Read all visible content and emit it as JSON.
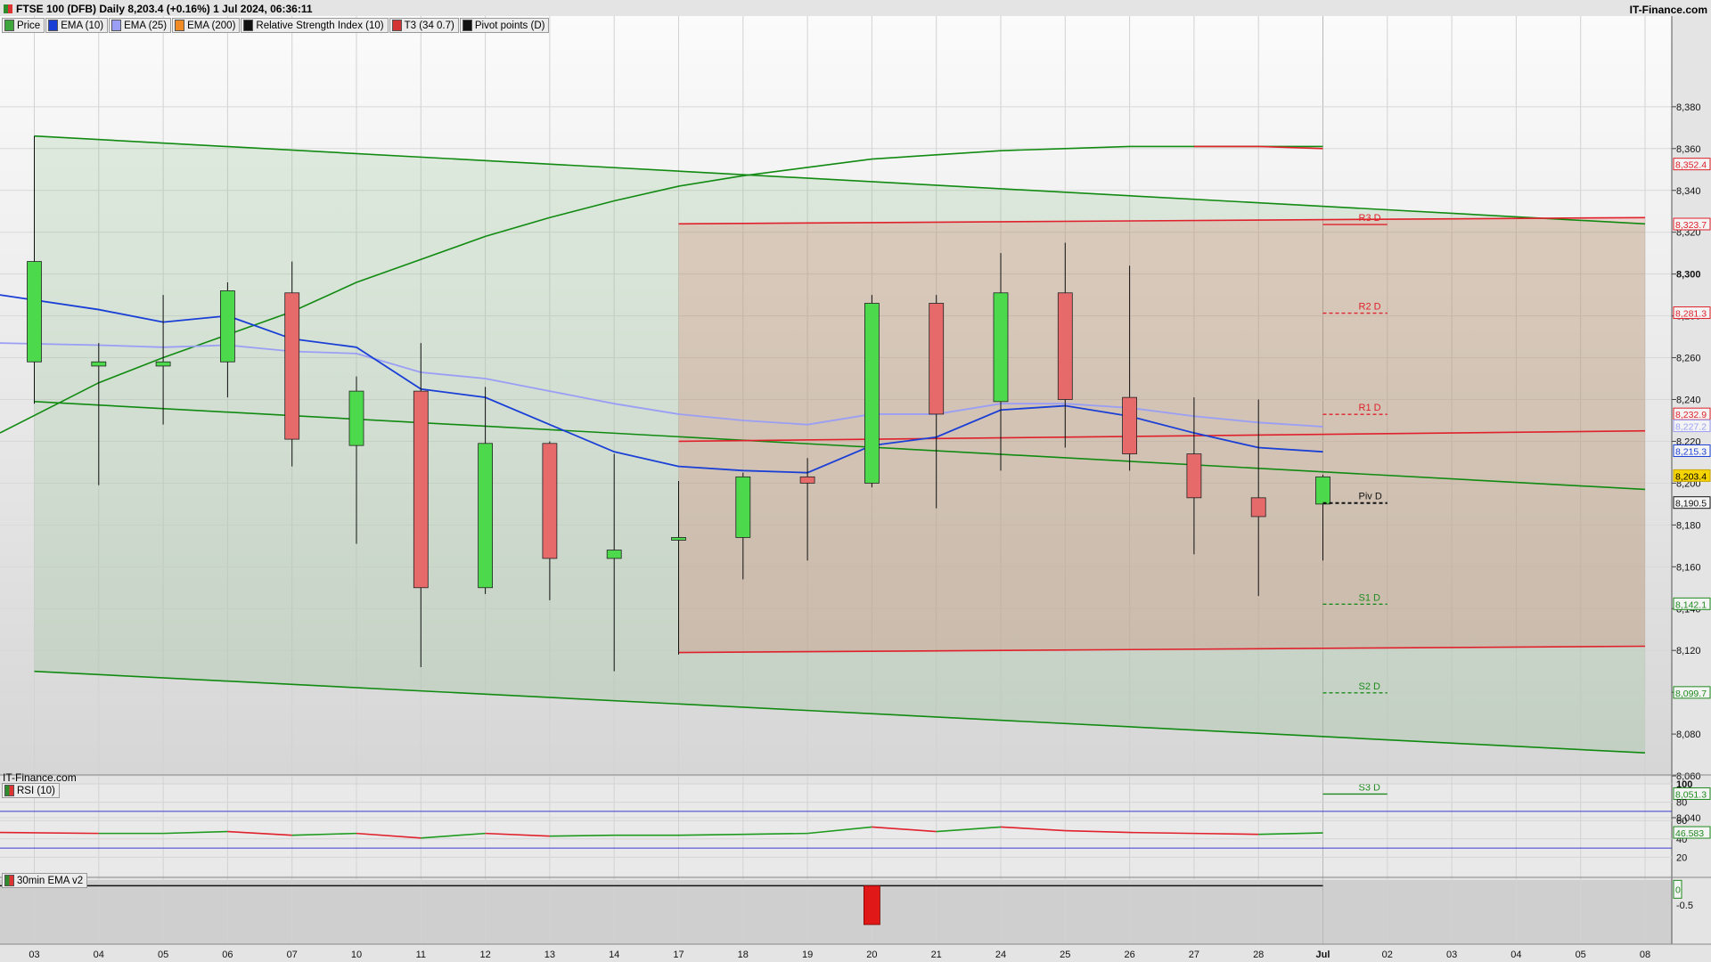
{
  "header": {
    "title": "FTSE 100 (DFB) Daily 8,203.4 (+0.16%) 1 Jul 2024, 06:36:11",
    "brand": "IT-Finance.com",
    "watermark": "IT-Finance.com"
  },
  "legend": [
    {
      "label": "Price",
      "color": "#3da63d"
    },
    {
      "label": "EMA (10)",
      "color": "#1a3fd6"
    },
    {
      "label": "EMA (25)",
      "color": "#9a9ef5"
    },
    {
      "label": "EMA (200)",
      "color": "#f08a24"
    },
    {
      "label": "Relative Strength Index (10)",
      "color": "#111111"
    },
    {
      "label": "T3 (34 0.7)",
      "color": "#d33333"
    },
    {
      "label": "Pivot points (D)",
      "color": "#111111"
    }
  ],
  "panels": {
    "rsi_label": "RSI (10)",
    "ema30_label": "30min EMA v2"
  },
  "colors": {
    "up": "#4cd94c",
    "down": "#e66a6a",
    "ema10": "#1a3fd6",
    "ema25": "#9a9ef5",
    "channel": "#118a11",
    "box": "#e0202a",
    "current": "#f5d400"
  },
  "chart_data": [
    {
      "type": "candlestick",
      "x": [
        "03",
        "04",
        "05",
        "06",
        "07",
        "10",
        "11",
        "12",
        "13",
        "14",
        "17",
        "18",
        "19",
        "20",
        "21",
        "24",
        "25",
        "26",
        "27",
        "28",
        "Jul"
      ],
      "future_x": [
        "02",
        "03",
        "04",
        "05",
        "08"
      ],
      "ylim": [
        8023,
        8388
      ],
      "y_ticks": [
        8040,
        8060,
        8080,
        8100,
        8120,
        8140,
        8160,
        8180,
        8200,
        8220,
        8240,
        8260,
        8280,
        8300,
        8320,
        8340,
        8360,
        8380
      ],
      "ohlc": [
        [
          8258,
          8366,
          8238,
          8306
        ],
        [
          8256,
          8267,
          8199,
          8258
        ],
        [
          8256,
          8290,
          8228,
          8258
        ],
        [
          8258,
          8296,
          8241,
          8292
        ],
        [
          8291,
          8306,
          8208,
          8221
        ],
        [
          8218,
          8251,
          8171,
          8244
        ],
        [
          8244,
          8267,
          8112,
          8150
        ],
        [
          8150,
          8246,
          8147,
          8219
        ],
        [
          8219,
          8220,
          8144,
          8164
        ],
        [
          8164,
          8214,
          8110,
          8168
        ],
        [
          8174,
          8201,
          8118,
          8174
        ],
        [
          8174,
          8205,
          8154,
          8203
        ],
        [
          8203,
          8212,
          8163,
          8200
        ],
        [
          8200,
          8290,
          8198,
          8286
        ],
        [
          8286,
          8290,
          8188,
          8233
        ],
        [
          8239,
          8310,
          8206,
          8291
        ],
        [
          8291,
          8315,
          8217,
          8240
        ],
        [
          8241,
          8304,
          8206,
          8214
        ],
        [
          8214,
          8241,
          8166,
          8193
        ],
        [
          8193,
          8240,
          8146,
          8184
        ],
        [
          8190,
          8204,
          8163,
          8203
        ]
      ],
      "ema10": [
        8290,
        8283,
        8277,
        8280,
        8269,
        8265,
        8245,
        8241,
        8228,
        8215,
        8208,
        8206,
        8205,
        8218,
        8222,
        8235,
        8237,
        8232,
        8224,
        8217,
        8215
      ],
      "ema25": [
        8267,
        8266,
        8265,
        8266,
        8263,
        8262,
        8253,
        8250,
        8244,
        8238,
        8233,
        8230,
        8228,
        8233,
        8233,
        8238,
        8238,
        8236,
        8232,
        8229,
        8227
      ],
      "curve_upper": [
        8224,
        8248,
        8260,
        8271,
        8282,
        8296,
        8307,
        8318,
        8327,
        8335,
        8342,
        8347,
        8351,
        8355,
        8357,
        8359,
        8360,
        8361,
        8361,
        8361,
        8361
      ],
      "curve_red_tail": [
        8361,
        8361,
        8360
      ],
      "channel": {
        "upper": [
          [
            "03",
            8366
          ],
          [
            "08",
            8324
          ]
        ],
        "middle": [
          [
            "03",
            8239
          ],
          [
            "08",
            8197
          ]
        ],
        "lower": [
          [
            "03",
            8110
          ],
          [
            "08",
            8071
          ]
        ]
      },
      "box": {
        "top": [
          [
            "17",
            8324
          ],
          [
            "08",
            8327
          ]
        ],
        "middle": [
          [
            "17",
            8220
          ],
          [
            "08",
            8225
          ]
        ],
        "bottom": [
          [
            "17",
            8119
          ],
          [
            "08",
            8122
          ]
        ]
      },
      "pivots": [
        {
          "label": "R3 D",
          "value": 8323.7,
          "tag": "8,323.7"
        },
        {
          "label": "R2 D",
          "value": 8281.3,
          "tag": "8,281.3"
        },
        {
          "label": "R1 D",
          "value": 8232.9,
          "tag": "8,232.9"
        },
        {
          "label": "Piv D",
          "value": 8190.5,
          "tag": "8,190.5"
        },
        {
          "label": "S1 D",
          "value": 8142.1,
          "tag": "8,142.1"
        },
        {
          "label": "S2 D",
          "value": 8099.7,
          "tag": "8,099.7"
        },
        {
          "label": "S3 D",
          "value": 8051.3,
          "tag": "8,051.3"
        }
      ],
      "price_tags": [
        {
          "value": 8352.4,
          "tag": "8,352.4",
          "color": "#e0202a"
        },
        {
          "value": 8227.2,
          "tag": "8,227.2",
          "color": "#9a9ef5"
        },
        {
          "value": 8215.3,
          "tag": "8,215.3",
          "color": "#1a3fd6"
        },
        {
          "value": 8203.4,
          "tag": "8,203.4",
          "color": "#000000",
          "current": true
        }
      ]
    },
    {
      "type": "line",
      "name": "RSI (10)",
      "ylim": [
        0,
        100
      ],
      "y_ticks": [
        20,
        40,
        60,
        80,
        100
      ],
      "bands": [
        70,
        30
      ],
      "values": [
        47,
        46,
        46,
        48,
        44,
        46,
        41,
        46,
        43,
        44,
        44,
        45,
        46,
        53,
        48,
        53,
        49,
        47,
        46,
        45,
        46.583
      ],
      "value_tag": "46.583"
    },
    {
      "type": "bar",
      "name": "30min EMA v2",
      "ylim": [
        -1.1,
        0.15
      ],
      "y_ticks": [
        0,
        -0.5
      ],
      "values": [
        0,
        0,
        0,
        0,
        0,
        0,
        0,
        0,
        0,
        0,
        0,
        0,
        0,
        -1,
        0,
        0,
        0,
        0,
        0,
        0,
        0
      ],
      "value_tag": "0"
    }
  ]
}
